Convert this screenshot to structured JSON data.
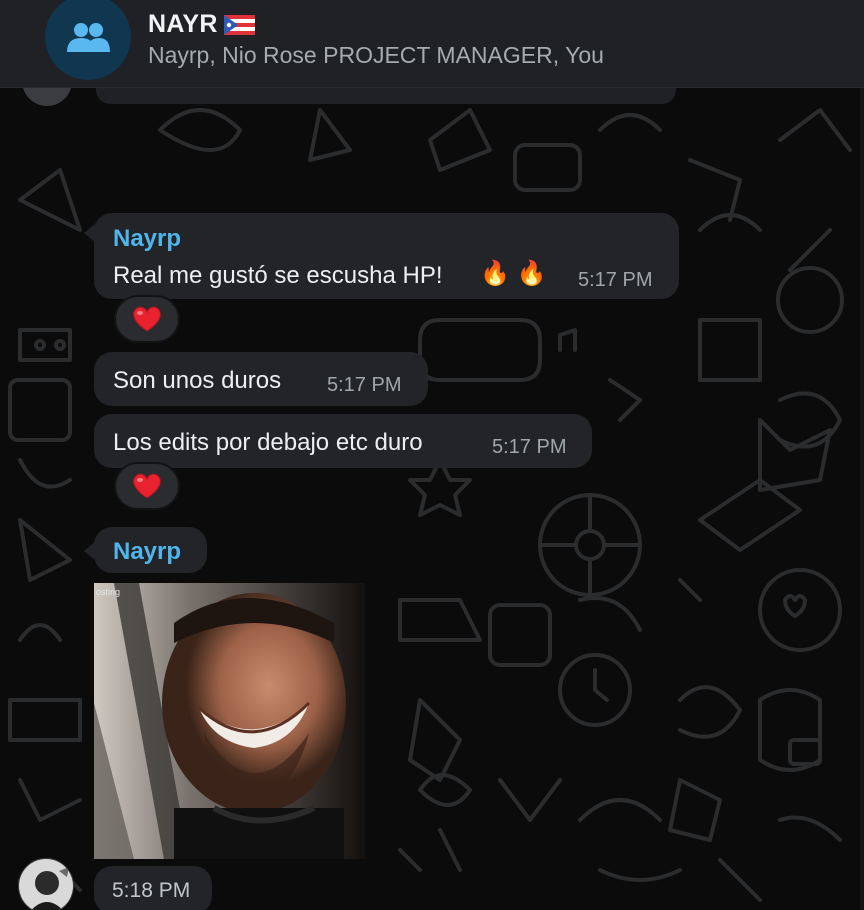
{
  "header": {
    "title": "NAYR",
    "flag_icon": "puerto-rico-flag",
    "participants": "Nayrp, Nio Rose PROJECT MANAGER, You"
  },
  "messages": [
    {
      "sender": "Nayrp",
      "text": "Real me gustó se escusha HP!",
      "emoji": "🔥 🔥",
      "time": "5:17 PM",
      "reaction": "❤️"
    },
    {
      "text": "Son unos duros",
      "time": "5:17 PM"
    },
    {
      "text": "Los edits por debajo etc duro",
      "time": "5:17 PM",
      "reaction": "❤️"
    },
    {
      "sender": "Nayrp",
      "media_caption": "osting",
      "time": "5:18 PM"
    }
  ],
  "colors": {
    "background": "#0b0b0c",
    "bubble": "#222427",
    "sender": "#4fb6ec",
    "header": "#1f2124"
  }
}
